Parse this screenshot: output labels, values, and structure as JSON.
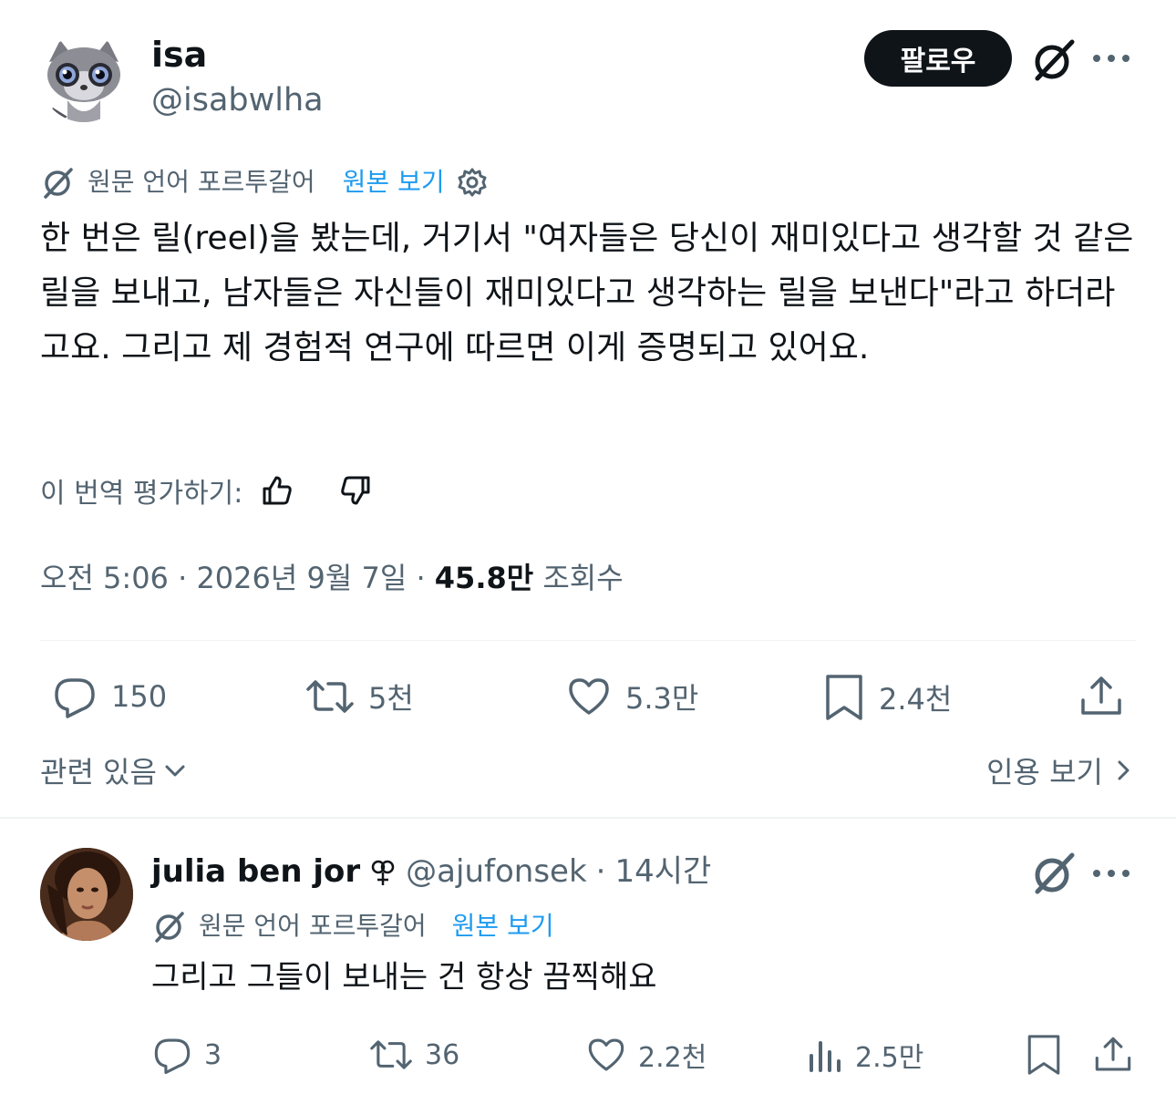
{
  "tweet": {
    "author_name": "isa",
    "author_handle": "@isabwlha",
    "follow_label": "팔로우",
    "translation_note": "원문 언어 포르투갈어",
    "view_original": "원본 보기",
    "text": "한 번은 릴(reel)을 봤는데, 거기서 \"여자들은 당신이 재미있다고 생각할 것 같은 릴을 보내고, 남자들은 자신들이 재미있다고 생각하는 릴을 보낸다\"라고 하더라고요. 그리고 제 경험적 연구에 따르면 이게 증명되고 있어요.",
    "rate_translation": "이 번역 평가하기:",
    "time": "오전 5:06",
    "date": "2026년 9월 7일",
    "views_count": "45.8만",
    "views_label": "조회수",
    "replies": "150",
    "reposts": "5천",
    "likes": "5.3만",
    "bookmarks": "2.4천",
    "related_label": "관련 있음",
    "quotes_label": "인용 보기"
  },
  "reply": {
    "author_name": "julia ben jor",
    "author_handle": "@ajufonsek",
    "time_ago": "14시간",
    "translation_note": "원문 언어 포르투갈어",
    "view_original": "원본 보기",
    "text": "그리고 그들이 보내는 건 항상 끔찍해요",
    "replies": "3",
    "reposts": "36",
    "likes": "2.2천",
    "views": "2.5만"
  },
  "colors": {
    "text": "#0f1419",
    "secondary": "#536471",
    "link": "#1d9bf0",
    "divider": "#eff3f4",
    "button_bg": "#0f1419"
  }
}
